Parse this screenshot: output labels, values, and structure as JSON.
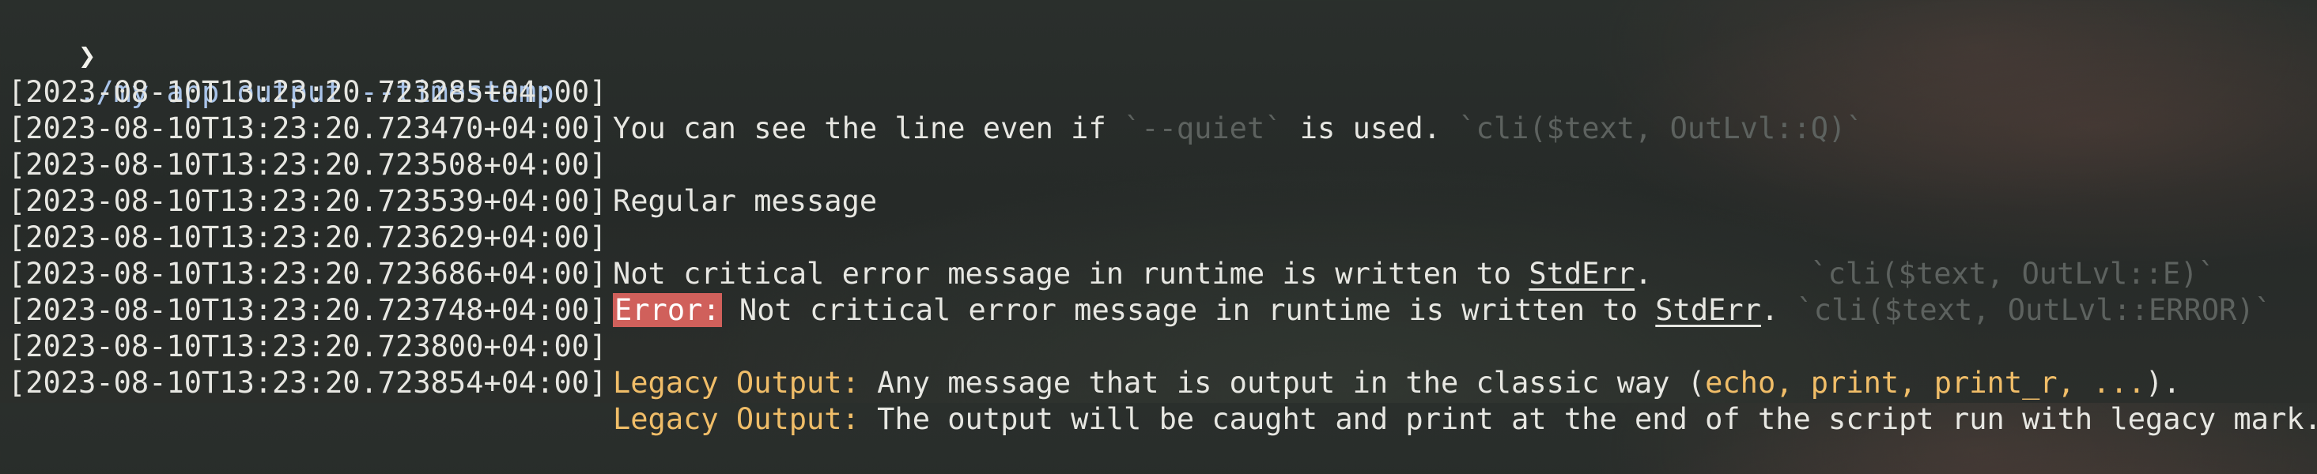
{
  "prompt": {
    "symbol": "❯",
    "command": "./my-app output --timestamp"
  },
  "colors": {
    "background": "#282c2a",
    "text": "#e7e7e2",
    "command": "#a9c4ea",
    "dim": "#5d625f",
    "legacy": "#f0bd68",
    "error_badge": "#d0605b"
  },
  "lines": [
    {
      "timestamp": "[2023-08-10T13:23:20.723285+04:00]",
      "text": "You can see the line even if ",
      "code1": "`--quiet`",
      "text2": " is used. ",
      "code2": "`cli($text, OutLvl::Q)`"
    },
    {
      "timestamp": "[2023-08-10T13:23:20.723470+04:00]"
    },
    {
      "timestamp": "[2023-08-10T13:23:20.723508+04:00]",
      "text": "Regular message"
    },
    {
      "timestamp": "[2023-08-10T13:23:20.723539+04:00]"
    },
    {
      "timestamp": "[2023-08-10T13:23:20.723629+04:00]",
      "text": "Not critical error message in runtime is written to ",
      "link": "StdErr",
      "text2": ".",
      "code": "`cli($text, OutLvl::E)`"
    },
    {
      "timestamp": "[2023-08-10T13:23:20.723686+04:00]",
      "badge": "Error:",
      "text": " Not critical error message in runtime is written to ",
      "link": "StdErr",
      "text2": ". ",
      "code": "`cli($text, OutLvl::ERROR)`"
    },
    {
      "timestamp": "[2023-08-10T13:23:20.723748+04:00]"
    },
    {
      "timestamp": "[2023-08-10T13:23:20.723800+04:00]",
      "label": "Legacy Output:",
      "text": " Any message that is output in the classic way (",
      "highlight": "echo, print, print_r, ...",
      "text2": ")."
    },
    {
      "timestamp": "[2023-08-10T13:23:20.723854+04:00]",
      "label": "Legacy Output:",
      "text": " The output will be caught and print at the end of the script run with legacy mark."
    }
  ]
}
